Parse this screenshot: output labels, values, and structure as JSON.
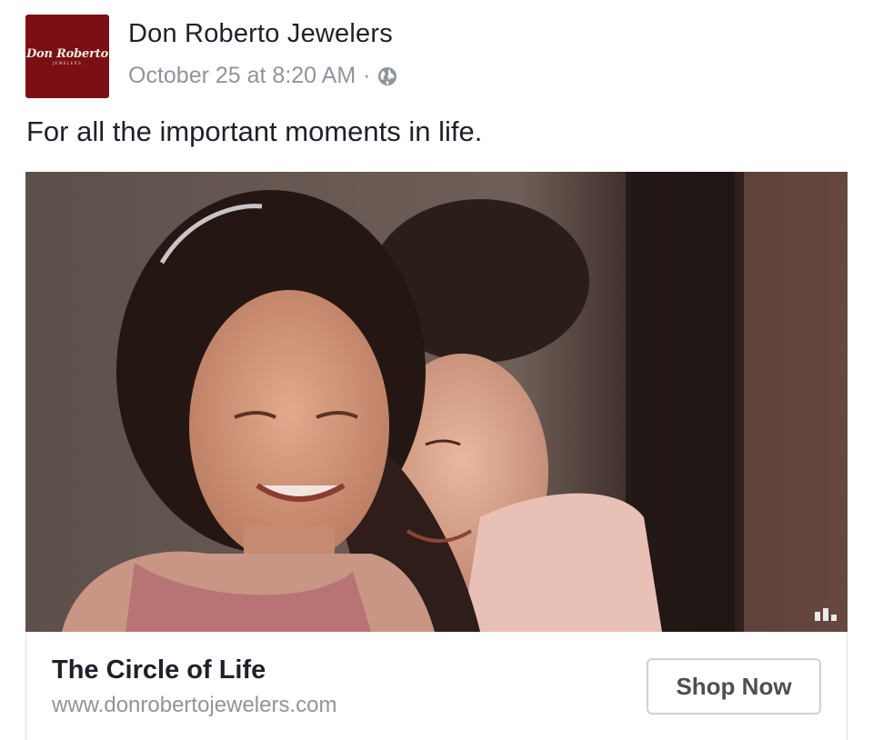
{
  "post": {
    "page_name": "Don Roberto Jewelers",
    "timestamp": "October 25 at 8:20 AM",
    "separator": "·",
    "privacy_icon": "globe-icon",
    "text": "For all the important moments in life."
  },
  "avatar": {
    "logo_text": "Don Roberto",
    "logo_subtext": "JEWELERS",
    "background_color": "#7b0f13"
  },
  "media": {
    "type": "video",
    "indicator_icon": "video-bars-icon"
  },
  "link": {
    "title": "The Circle of Life",
    "url": "www.donrobertojewelers.com",
    "cta_label": "Shop Now"
  }
}
